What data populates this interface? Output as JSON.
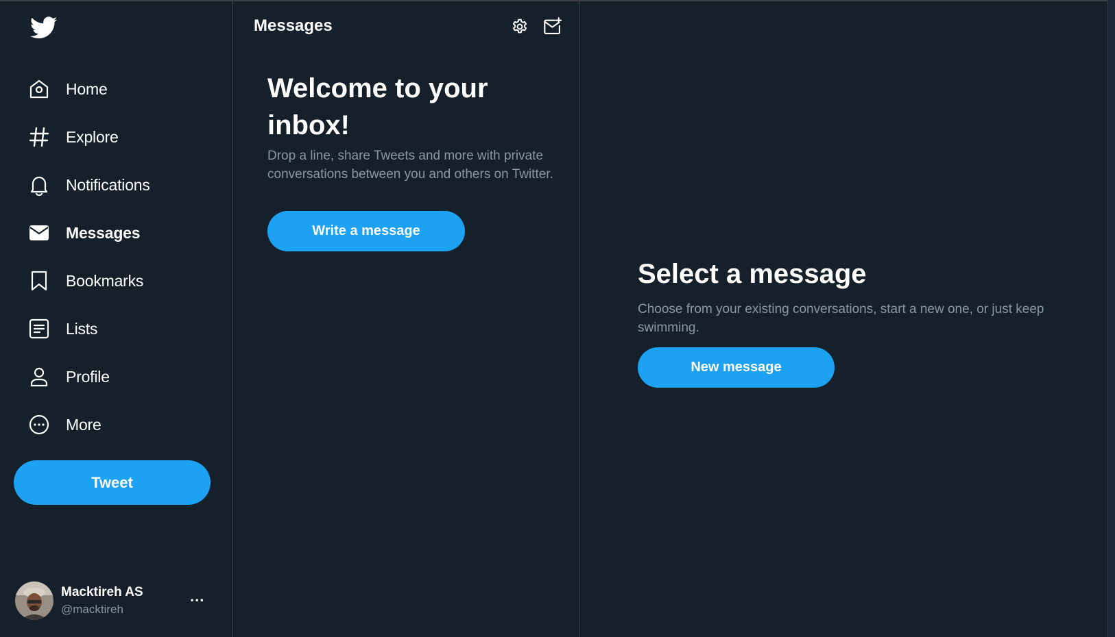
{
  "colors": {
    "background": "#15202b",
    "accent": "#1da1f2",
    "secondary_text": "#8899a6",
    "border": "#38444d"
  },
  "sidebar": {
    "logo_icon": "twitter-bird-icon",
    "items": [
      {
        "label": "Home",
        "icon": "home-icon"
      },
      {
        "label": "Explore",
        "icon": "hashtag-icon"
      },
      {
        "label": "Notifications",
        "icon": "bell-icon"
      },
      {
        "label": "Messages",
        "icon": "envelope-icon",
        "active": true
      },
      {
        "label": "Bookmarks",
        "icon": "bookmark-icon"
      },
      {
        "label": "Lists",
        "icon": "list-icon"
      },
      {
        "label": "Profile",
        "icon": "person-icon"
      },
      {
        "label": "More",
        "icon": "more-circle-icon"
      }
    ],
    "tweet_label": "Tweet",
    "account": {
      "name": "Macktireh AS",
      "handle": "@macktireh",
      "more_label": "..."
    }
  },
  "messages": {
    "title": "Messages",
    "settings_icon": "gear-icon",
    "compose_icon": "new-message-icon",
    "welcome_title": "Welcome to your inbox!",
    "welcome_subtitle": "Drop a line, share Tweets and more with private conversations between you and others on Twitter.",
    "write_button": "Write a message"
  },
  "detail": {
    "title": "Select a message",
    "subtitle": "Choose from your existing conversations, start a new one, or just keep swimming.",
    "new_button": "New message"
  }
}
